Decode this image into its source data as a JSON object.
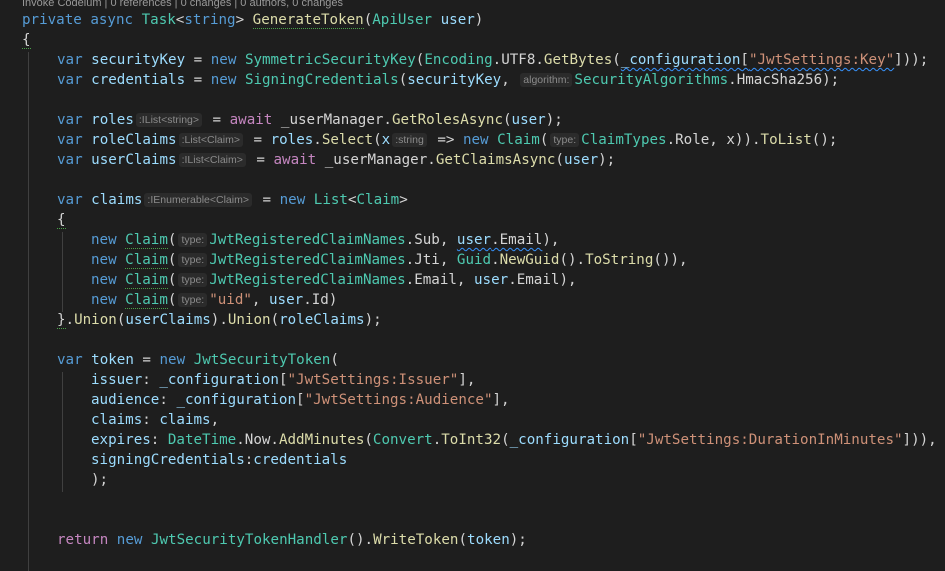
{
  "codelens": "Invoke Codeium | 0 references | 0 changes | 0 authors, 0 changes",
  "code": {
    "sig_private": "private",
    "sig_async": "async",
    "sig_task": "Task",
    "sig_lt": "<",
    "sig_string": "string",
    "sig_gt": ">",
    "sig_name": "GenerateToken",
    "sig_open": "(",
    "sig_param_type": "ApiUser",
    "sig_param": "user",
    "sig_close": ")",
    "brace_open": "{",
    "var": "var",
    "new": "new",
    "await": "await",
    "return": "return",
    "l1_name": "securityKey",
    "l1_eq": " = ",
    "l1_type": "SymmetricSecurityKey",
    "l1_enc": "Encoding",
    "l1_utf8": ".UTF8.",
    "l1_getbytes": "GetBytes",
    "l1_conf": "_configuration",
    "l1_key": "\"JwtSettings:Key\"",
    "l1_end": "]));",
    "l2_name": "credentials",
    "l2_type": "SigningCredentials",
    "l2_arg": "securityKey",
    "l2_hint": "algorithm:",
    "l2_alg": "SecurityAlgorithms",
    "l2_alg_val": ".HmacSha256",
    "l2_end": ");",
    "l3_name": "roles",
    "l3_hint": ":IList<string>",
    "l3_um": "_userManager.",
    "l3_fn": "GetRolesAsync",
    "l3_arg": "user",
    "l3_end": ");",
    "l4_name": "roleClaims",
    "l4_hint": ":List<Claim>",
    "l4_roles": "roles",
    "l4_select": "Select",
    "l4_x": "x",
    "l4_xhint": ":string",
    "l4_arrow": " => ",
    "l4_claim": "Claim",
    "l4_type_hint": "type:",
    "l4_ct": "ClaimTypes",
    "l4_role": ".Role, x)).",
    "l4_tolist": "ToList",
    "l4_end": "();",
    "l5_name": "userClaims",
    "l5_hint": ":IList<Claim>",
    "l5_fn": "GetClaimsAsync",
    "l5_arg": "user",
    "l5_end": ");",
    "l6_name": "claims",
    "l6_hint": ":IEnumerable<Claim>",
    "l6_list": "List",
    "l6_claim": "Claim",
    "brace_inner_open": "{",
    "c_claim": "Claim",
    "c_type_hint": "type:",
    "c_reg": "JwtRegisteredClaimNames",
    "c1_sub": ".Sub, ",
    "c1_user": "user",
    "c1_email": ".Email",
    "c1_end": "),",
    "c2_jti": ".Jti, ",
    "c2_guid": "Guid",
    "c2_newguid": "NewGuid",
    "c2_tostring": "ToString",
    "c2_end": "()),",
    "c3_email": ".Email, ",
    "c3_user": "user",
    "c3_email2": ".Email",
    "c3_end": "),",
    "c4_uid": "\"uid\"",
    "c4_user": "user",
    "c4_id": ".Id",
    "c4_end": ")",
    "union_close": "}",
    "union_dot": ".",
    "union_fn": "Union",
    "union_arg1": "userClaims",
    "union_fn2": "Union",
    "union_arg2": "roleClaims",
    "union_end": ");",
    "t_name": "token",
    "t_type": "JwtSecurityToken",
    "t_issuer_p": "issuer",
    "t_conf": "_configuration",
    "t_issuer_s": "\"JwtSettings:Issuer\"",
    "t_aud_p": "audience",
    "t_aud_s": "\"JwtSettings:Audience\"",
    "t_claims_p": "claims",
    "t_claims_v": "claims",
    "t_exp_p": "expires",
    "t_dt": "DateTime",
    "t_now": ".Now.",
    "t_addmin": "AddMinutes",
    "t_convert": "Convert",
    "t_toint": "ToInt32",
    "t_dur_s": "\"JwtSettings:DurationInMinutes\"",
    "t_exp_end": "])),",
    "t_sc_p": "signingCredentials",
    "t_sc_v": "credentials",
    "t_end": ");",
    "r_handler": "JwtSecurityTokenHandler",
    "r_write": "WriteToken",
    "r_arg": "token",
    "r_end": ");"
  }
}
